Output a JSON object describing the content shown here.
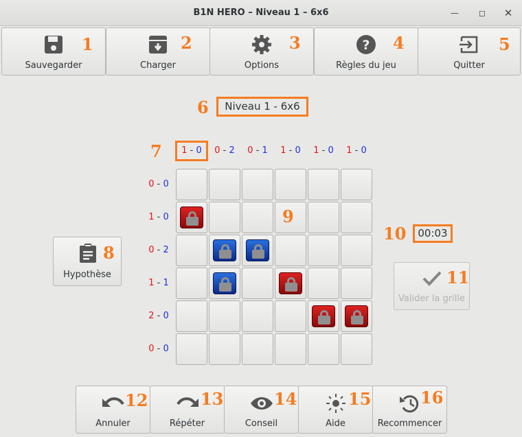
{
  "window": {
    "title": "B1N HERO – Niveau 1 – 6x6",
    "minimize_icon": "minimize-icon",
    "maximize_icon": "maximize-icon",
    "close_icon": "close-icon"
  },
  "toolbar": {
    "items": [
      {
        "label": "Sauvegarder",
        "icon": "save-icon",
        "number": "1"
      },
      {
        "label": "Charger",
        "icon": "load-icon",
        "number": "2"
      },
      {
        "label": "Options",
        "icon": "gear-icon",
        "number": "3"
      },
      {
        "label": "Règles du jeu",
        "icon": "help-icon",
        "number": "4"
      },
      {
        "label": "Quitter",
        "icon": "exit-icon",
        "number": "5"
      }
    ]
  },
  "level": {
    "title": "Niveau 1 - 6x6",
    "number": "6"
  },
  "column_clues": {
    "number": "7",
    "items": [
      {
        "red": "1",
        "blue": "0"
      },
      {
        "red": "0",
        "blue": "2"
      },
      {
        "red": "0",
        "blue": "1"
      },
      {
        "red": "1",
        "blue": "0"
      },
      {
        "red": "1",
        "blue": "0"
      },
      {
        "red": "1",
        "blue": "0"
      }
    ]
  },
  "row_clues": [
    {
      "red": "0",
      "blue": "0"
    },
    {
      "red": "1",
      "blue": "0"
    },
    {
      "red": "0",
      "blue": "2"
    },
    {
      "red": "1",
      "blue": "1"
    },
    {
      "red": "2",
      "blue": "0"
    },
    {
      "red": "0",
      "blue": "0"
    }
  ],
  "grid": {
    "number": "9",
    "rows": [
      [
        "",
        "",
        "",
        "",
        "",
        ""
      ],
      [
        "red",
        "",
        "",
        "",
        "",
        ""
      ],
      [
        "",
        "blue",
        "blue",
        "",
        "",
        ""
      ],
      [
        "",
        "blue",
        "",
        "red",
        "",
        ""
      ],
      [
        "",
        "",
        "",
        "",
        "red",
        "red"
      ],
      [
        "",
        "",
        "",
        "",
        "",
        ""
      ]
    ]
  },
  "hypothesis_button": {
    "label": "Hypothèse",
    "icon": "clipboard-icon",
    "number": "8"
  },
  "timer": {
    "value": "00:03",
    "number": "10"
  },
  "validate_button": {
    "label": "Valider la grille",
    "icon": "checkmark-icon",
    "number": "11"
  },
  "bottom_bar": {
    "items": [
      {
        "label": "Annuler",
        "icon": "undo-icon",
        "number": "12"
      },
      {
        "label": "Répéter",
        "icon": "redo-icon",
        "number": "13"
      },
      {
        "label": "Conseil",
        "icon": "eye-icon",
        "number": "14"
      },
      {
        "label": "Aide",
        "icon": "brightness-icon",
        "number": "15"
      },
      {
        "label": "Recommencer",
        "icon": "history-icon",
        "number": "16"
      }
    ]
  },
  "colors": {
    "accent_orange": "#f57c20",
    "red_clue": "#e31414",
    "blue_clue": "#1e30d8",
    "red_piece": "#cc1f1f",
    "blue_piece": "#1f5cd0"
  }
}
